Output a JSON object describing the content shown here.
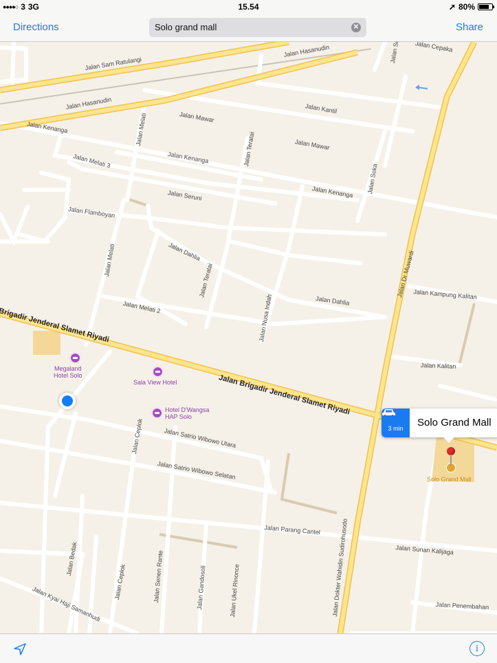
{
  "status_bar": {
    "carrier": "3",
    "network": "3G",
    "time": "15.54",
    "battery": "80%",
    "battery_level": 0.8,
    "signal_bars": 4
  },
  "toolbar": {
    "directions_label": "Directions",
    "search_value": "Solo grand mall",
    "share_label": "Share"
  },
  "map": {
    "roads": [
      "Jalan Sam Ratulangi",
      "Jalan Hasanudin",
      "Jalan Hasanudin",
      "Jalan Kenanga",
      "Jalan Melati",
      "Jalan Mawar",
      "Jalan Kantil",
      "Jalan Mawar",
      "Jalan Teratai",
      "Jalan Soka",
      "Jalan Soka",
      "Jalan Cepaka",
      "Jalan Melati 3",
      "Jalan Kenanga",
      "Jalan Kenanga",
      "Jalan Seruni",
      "Jalan Flamboyan",
      "Jalan Dahlia",
      "Jalan Dr Muwardi",
      "Jalan Melati",
      "Jalan Teratai",
      "Jalan Dahlia",
      "Jalan Kampung Kalitan",
      "Jalan Nusa Indah",
      "Jalan Melati 2",
      "Brigadir Jenderal Slamet Riyadi",
      "Jalan Brigadir Jenderal Slamet Riyadi",
      "Jalan Kalitan",
      "Jalan Satrio Wibowo Utara",
      "Jalan Ceplok",
      "Jalan Satrio Wibowo Selatan",
      "Jalan Parang Cantel",
      "Jalan Dokter Wahidin Sudirohusodo",
      "Jalan Sunan Kalijaga",
      "Jalan Bedak",
      "Jalan Ceplok",
      "Jalan Senen Rante",
      "Jalan Gandosoli",
      "Jalan Ukel Rinonce",
      "Jalan Kyai Haji Samanhudi",
      "Jalan Penembahan"
    ],
    "pois": [
      {
        "name": "Megaland Hotel Solo",
        "line1": "Megaland",
        "line2": "Hotel Solo"
      },
      {
        "name": "Sala View Hotel",
        "line1": "Sala View Hotel",
        "line2": ""
      },
      {
        "name": "Hotel D'Wangsa HAP Solo",
        "line1": "Hotel D'Wangsa",
        "line2": "HAP Solo"
      },
      {
        "name": "Solo Grand Mall",
        "line1": "Solo Grand Mall",
        "line2": ""
      }
    ],
    "callout": {
      "title": "Solo Grand Mall",
      "drive_time": "3 min",
      "drive_icon": "car-icon"
    }
  },
  "bottom_bar": {
    "tracking_icon": "location-arrow-icon",
    "info_icon": "info-icon"
  },
  "colors": {
    "accent": "#1a7bf0",
    "major_road": "#fbd96a",
    "map_background": "#f6f1e8",
    "poi": "#a94bc4",
    "pin": "#e22b2b"
  }
}
